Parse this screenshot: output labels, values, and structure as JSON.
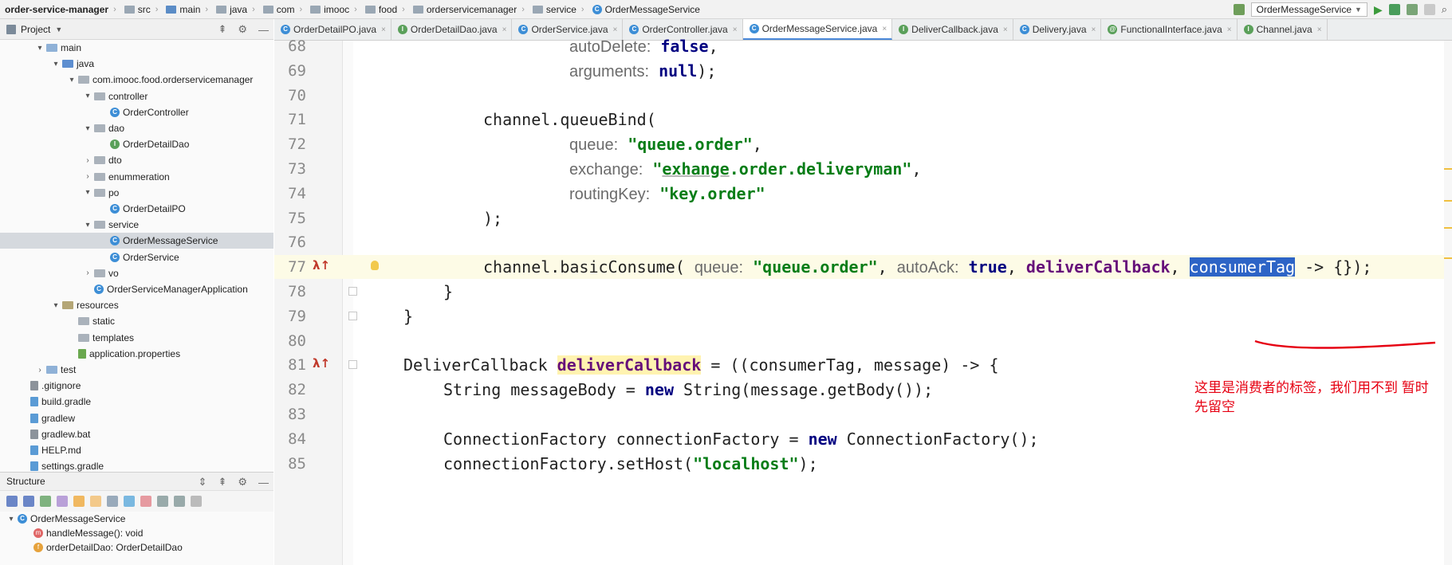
{
  "breadcrumb": [
    "order-service-manager",
    "src",
    "main",
    "java",
    "com",
    "imooc",
    "food",
    "orderservicemanager",
    "service",
    "OrderMessageService"
  ],
  "run_config": "OrderMessageService",
  "project_panel": {
    "title": "Project"
  },
  "tree": [
    {
      "label": "main",
      "indent": 60,
      "arrow": "▾",
      "icon": "f-src"
    },
    {
      "label": "java",
      "indent": 80,
      "arrow": "▾",
      "icon": "f-blue"
    },
    {
      "label": "com.imooc.food.orderservicemanager",
      "indent": 100,
      "arrow": "▾",
      "icon": "f-gray"
    },
    {
      "label": "controller",
      "indent": 120,
      "arrow": "▾",
      "icon": "f-gray"
    },
    {
      "label": "OrderController",
      "indent": 140,
      "arrow": "",
      "icon": "c"
    },
    {
      "label": "dao",
      "indent": 120,
      "arrow": "▾",
      "icon": "f-gray"
    },
    {
      "label": "OrderDetailDao",
      "indent": 140,
      "arrow": "",
      "icon": "i"
    },
    {
      "label": "dto",
      "indent": 120,
      "arrow": "›",
      "icon": "f-gray"
    },
    {
      "label": "enummeration",
      "indent": 120,
      "arrow": "›",
      "icon": "f-gray"
    },
    {
      "label": "po",
      "indent": 120,
      "arrow": "▾",
      "icon": "f-gray"
    },
    {
      "label": "OrderDetailPO",
      "indent": 140,
      "arrow": "",
      "icon": "c"
    },
    {
      "label": "service",
      "indent": 120,
      "arrow": "▾",
      "icon": "f-gray"
    },
    {
      "label": "OrderMessageService",
      "indent": 140,
      "arrow": "",
      "icon": "c",
      "selected": true
    },
    {
      "label": "OrderService",
      "indent": 140,
      "arrow": "",
      "icon": "c"
    },
    {
      "label": "vo",
      "indent": 120,
      "arrow": "›",
      "icon": "f-gray"
    },
    {
      "label": "OrderServiceManagerApplication",
      "indent": 120,
      "arrow": "",
      "icon": "c"
    },
    {
      "label": "resources",
      "indent": 80,
      "arrow": "▾",
      "icon": "f-res"
    },
    {
      "label": "static",
      "indent": 100,
      "arrow": "",
      "icon": "f-gray"
    },
    {
      "label": "templates",
      "indent": 100,
      "arrow": "",
      "icon": "f-gray"
    },
    {
      "label": "application.properties",
      "indent": 100,
      "arrow": "",
      "icon": "file-p"
    },
    {
      "label": "test",
      "indent": 60,
      "arrow": "›",
      "icon": "f-src"
    },
    {
      "label": ".gitignore",
      "indent": 40,
      "arrow": "",
      "icon": "file"
    },
    {
      "label": "build.gradle",
      "indent": 40,
      "arrow": "",
      "icon": "file-g"
    },
    {
      "label": "gradlew",
      "indent": 40,
      "arrow": "",
      "icon": "file-g"
    },
    {
      "label": "gradlew.bat",
      "indent": 40,
      "arrow": "",
      "icon": "file"
    },
    {
      "label": "HELP.md",
      "indent": 40,
      "arrow": "",
      "icon": "file-g"
    },
    {
      "label": "settings.gradle",
      "indent": 40,
      "arrow": "",
      "icon": "file-g"
    }
  ],
  "structure_panel": {
    "title": "Structure",
    "items": [
      {
        "label": "OrderMessageService",
        "icon": "c",
        "indent": 8,
        "arrow": "▾"
      },
      {
        "label": "handleMessage(): void",
        "icon": "m",
        "indent": 40,
        "arrow": ""
      },
      {
        "label": "orderDetailDao: OrderDetailDao",
        "icon": "f",
        "indent": 40,
        "arrow": ""
      }
    ]
  },
  "tabs": [
    {
      "label": "OrderDetailPO.java",
      "icon": "c",
      "active": false
    },
    {
      "label": "OrderDetailDao.java",
      "icon": "i",
      "active": false
    },
    {
      "label": "OrderService.java",
      "icon": "c",
      "active": false
    },
    {
      "label": "OrderController.java",
      "icon": "c",
      "active": false
    },
    {
      "label": "OrderMessageService.java",
      "icon": "c",
      "active": true
    },
    {
      "label": "DeliverCallback.java",
      "icon": "i",
      "active": false
    },
    {
      "label": "Delivery.java",
      "icon": "c",
      "active": false
    },
    {
      "label": "FunctionalInterface.java",
      "icon": "a",
      "active": false
    },
    {
      "label": "Channel.java",
      "icon": "i",
      "active": false
    }
  ],
  "code_lines": [
    {
      "n": "68",
      "text": "autoDelete: false,"
    },
    {
      "n": "69",
      "text": "arguments: null);"
    },
    {
      "n": "70",
      "text": ""
    },
    {
      "n": "71",
      "text": "channel.queueBind("
    },
    {
      "n": "72",
      "text": "queue: \"queue.order\","
    },
    {
      "n": "73",
      "text": "exchange: \"exhange.order.deliveryman\","
    },
    {
      "n": "74",
      "text": "routingKey: \"key.order\""
    },
    {
      "n": "75",
      "text": ");"
    },
    {
      "n": "76",
      "text": ""
    },
    {
      "n": "77",
      "text": "channel.basicConsume( queue: \"queue.order\", autoAck: true, deliverCallback, consumerTag -> {});"
    },
    {
      "n": "78",
      "text": "}"
    },
    {
      "n": "79",
      "text": "}"
    },
    {
      "n": "80",
      "text": ""
    },
    {
      "n": "81",
      "text": "DeliverCallback deliverCallback = ((consumerTag, message) -> {"
    },
    {
      "n": "82",
      "text": "String messageBody = new String(message.getBody());"
    },
    {
      "n": "83",
      "text": ""
    },
    {
      "n": "84",
      "text": "ConnectionFactory connectionFactory = new ConnectionFactory();"
    },
    {
      "n": "85",
      "text": "connectionFactory.setHost(\"localhost\");"
    }
  ],
  "annotation": "这里是消费者的标签，我们用不到 暂时先留空",
  "colors": {
    "keyword": "#000080",
    "string": "#067d17",
    "field": "#660e7a",
    "selection": "#2d64c6",
    "annotation": "#e60012"
  }
}
